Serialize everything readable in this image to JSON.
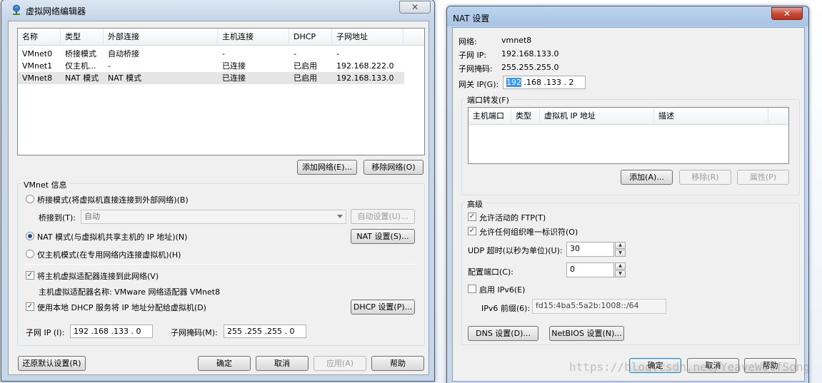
{
  "left_window": {
    "title": "虚拟网络编辑器",
    "close_glyph": "✕",
    "list": {
      "columns": [
        "名称",
        "类型",
        "外部连接",
        "主机连接",
        "DHCP",
        "子网地址"
      ],
      "rows": [
        [
          "VMnet0",
          "桥接模式",
          "自动桥接",
          "-",
          "-",
          "-"
        ],
        [
          "VMnet1",
          "仅主机...",
          "-",
          "已连接",
          "已启用",
          "192.168.222.0"
        ],
        [
          "VMnet8",
          "NAT 模式",
          "NAT 模式",
          "已连接",
          "已启用",
          "192.168.133.0"
        ]
      ]
    },
    "add_network_label": "添加网络(E)...",
    "remove_network_label": "移除网络(O)",
    "vmnet_info": {
      "title": "VMnet 信息",
      "bridged_label": "桥接模式(将虚拟机直接连接到外部网络)(B)",
      "bridge_to_label": "桥接到(T):",
      "bridge_to_value": "自动",
      "auto_settings_label": "自动设置(U)...",
      "nat_label": "NAT 模式(与虚拟机共享主机的 IP 地址)(N)",
      "nat_settings_label": "NAT 设置(S)...",
      "host_only_label": "仅主机模式(在专用网络内连接虚拟机)(H)",
      "connect_adapter_label": "将主机虚拟适配器连接到此网络(V)",
      "adapter_name_label": "主机虚拟适配器名称: VMware 网络适配器 VMnet8",
      "use_dhcp_label": "使用本地 DHCP 服务将 IP 地址分配给虚拟机(D)",
      "dhcp_settings_label": "DHCP 设置(P)...",
      "subnet_ip_label": "子网 IP (I):",
      "subnet_ip_value": "192 .168 .133 .  0",
      "subnet_mask_label": "子网掩码(M):",
      "subnet_mask_value": "255 .255 .255 .  0"
    },
    "restore_defaults_label": "还原默认设置(R)",
    "ok_label": "确定",
    "cancel_label": "取消",
    "apply_label": "应用(A)",
    "help_label": "帮助"
  },
  "right_window": {
    "title": "NAT 设置",
    "close_glyph": "✕",
    "network_label": "网络:",
    "network_value": "vmnet8",
    "subnet_ip_label": "子网 IP:",
    "subnet_ip_value": "192.168.133.0",
    "subnet_mask_label": "子网掩码:",
    "subnet_mask_value": "255.255.255.0",
    "gateway_label": "网关 IP(G):",
    "gateway_selected": "192",
    "gateway_rest": " .168 .133 .  2",
    "port_forward": {
      "title": "端口转发(F)",
      "columns": [
        "主机端口",
        "类型",
        "虚拟机 IP 地址",
        "描述"
      ],
      "add_label": "添加(A)...",
      "remove_label": "移除(R)",
      "properties_label": "属性(P)"
    },
    "advanced": {
      "title": "高级",
      "allow_ftp_label": "允许活动的 FTP(T)",
      "allow_uuid_label": "允许任何组织唯一标识符(O)",
      "udp_timeout_label": "UDP 超时(以秒为单位)(U):",
      "udp_timeout_value": "30",
      "config_port_label": "配置端口(C):",
      "config_port_value": "0",
      "enable_ipv6_label": "启用 IPv6(E)",
      "ipv6_prefix_label": "IPv6 前缀(6):",
      "ipv6_prefix_value": "fd15:4ba5:5a2b:1008::/64"
    },
    "dns_label": "DNS 设置(D)...",
    "netbios_label": "NetBIOS 设置(N)...",
    "ok_label": "确定",
    "cancel_label": "取消",
    "help_label": "帮助"
  },
  "watermark": "https://blog.csdn.net/YeaveWolfSong",
  "check_glyph": "✓",
  "spin_up_glyph": "▲",
  "spin_down_glyph": "▼"
}
